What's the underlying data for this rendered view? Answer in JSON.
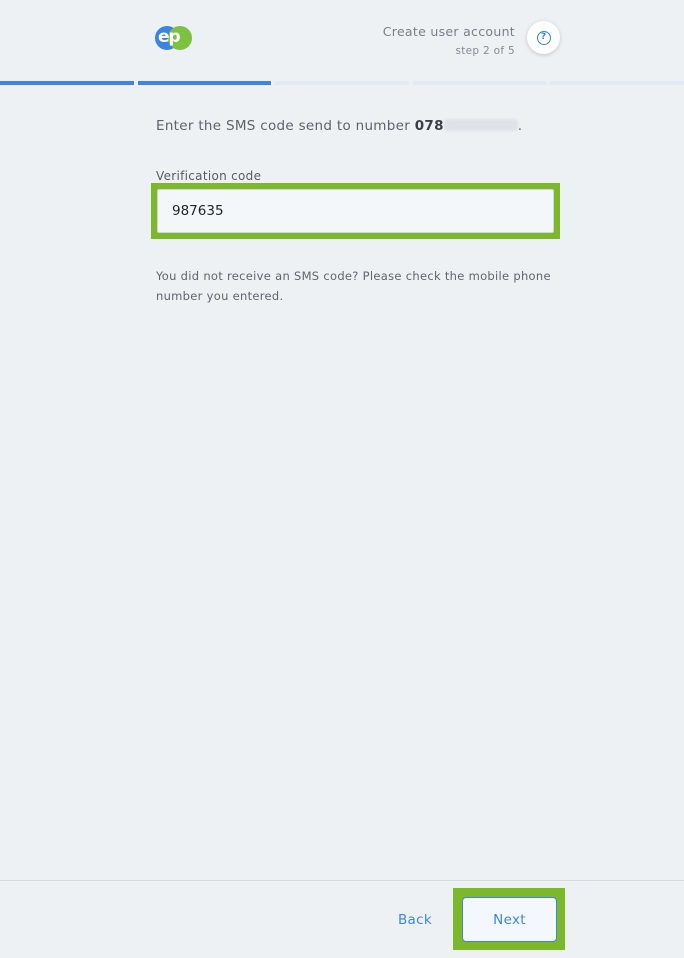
{
  "header": {
    "logo_text": "ep",
    "title": "Create user account",
    "step": "step 2 of 5",
    "help_icon": "question-circle-icon"
  },
  "progress": {
    "total_steps": 5,
    "current_step": 2
  },
  "main": {
    "prompt_prefix": "Enter the SMS code send to number ",
    "phone_visible": "078",
    "prompt_suffix": ".",
    "field_label": "Verification code",
    "field_value": "987635",
    "hint": "You did not receive an SMS code? Please check the mobile phone number you entered."
  },
  "footer": {
    "back_label": "Back",
    "next_label": "Next"
  },
  "colors": {
    "accent": "#3d86e4",
    "highlight": "#7cb82a",
    "logo_blue": "#3a85e0",
    "logo_green": "#7cc142"
  }
}
